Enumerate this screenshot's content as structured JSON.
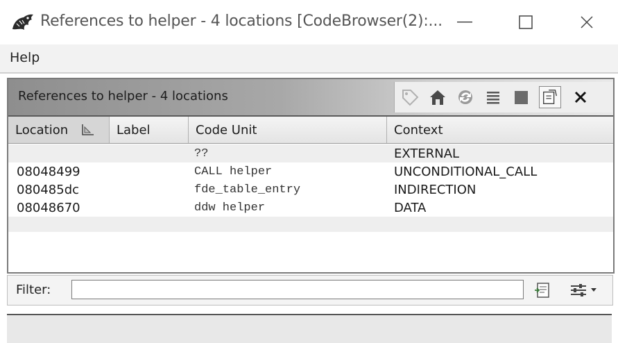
{
  "window": {
    "title": "References to helper - 4 locations [CodeBrowser(2):...",
    "controls": {
      "minimize": "—",
      "maximize": "☐",
      "close": "✕"
    }
  },
  "menubar": {
    "items": [
      "Help"
    ]
  },
  "panel": {
    "title": "References to helper - 4 locations",
    "toolbar_icons": [
      "tag-icon",
      "home-icon",
      "refresh-icon",
      "list-icon",
      "square-icon",
      "selection-icon",
      "close-icon"
    ],
    "close_glyph": "✕"
  },
  "table": {
    "columns": [
      "Location",
      "Label",
      "Code Unit",
      "Context"
    ],
    "rows": [
      {
        "location": "",
        "label": "",
        "code_unit": "??",
        "context": "EXTERNAL"
      },
      {
        "location": "08048499",
        "label": "",
        "code_unit": "CALL helper",
        "context": "UNCONDITIONAL_CALL"
      },
      {
        "location": "080485dc",
        "label": "",
        "code_unit": "fde_table_entry",
        "context": "INDIRECTION"
      },
      {
        "location": "08048670",
        "label": "",
        "code_unit": "ddw helper",
        "context": "DATA"
      }
    ]
  },
  "filter": {
    "label": "Filter:",
    "value": ""
  },
  "colors": {
    "header_dark": "#8e8e8e",
    "row_shade": "#eeeeee",
    "accent_orange": "#d9822b"
  }
}
